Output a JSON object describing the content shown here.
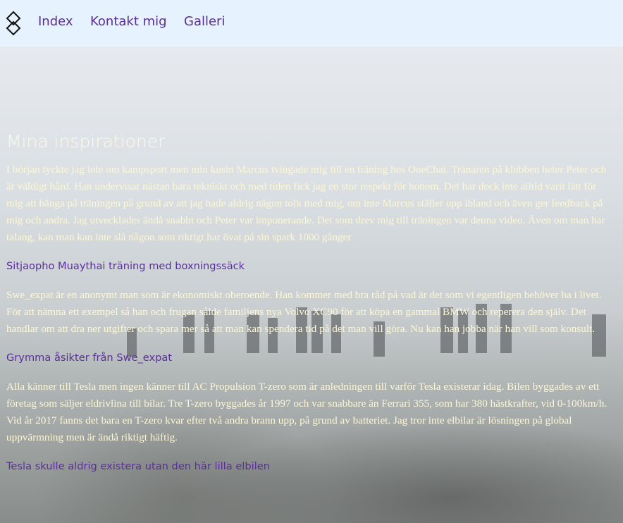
{
  "nav": {
    "logo_icon": "diamond-logo-icon",
    "links": [
      "Index",
      "Kontakt mig",
      "Galleri"
    ]
  },
  "main": {
    "heading": "Mina inspirationer",
    "paragraph_1": "I början tyckte jag inte om kampsport men min kusin Marcus tvingade mig till en träning hos OneChai. Tränaren på klubben heter Peter och är väldigt hård. Han undervisar nästan bara tekniskt och med tiden fick jag en stor respekt för honom. Det har dock inte alltid varit lätt för mig att hänga på träningen på grund av att jag hade aldrig någon tolk med mig, om inte Marcus ställer upp ibland och även ger feedback på mig och andra. Jag utvecklades ändå snabbt och Peter var imponerande. Det som drev mig till träningen var denna video. Även om man har talang, kan man kan inte slå någon som riktigt har övat på sin spark 1000 gånger",
    "link_1": "Sitjaopho Muaythai träning med boxningssäck",
    "paragraph_2": "Swe_expat är en anonymt man som är ekonomiskt oberoende. Han kommer med bra råd på vad är det som vi egentligen behöver ha i livet. För att nämna ett exempel så han och frugan sålde familjens nya Volvo XC90 för att köpa en gammal BMW och reperera den själv. Det handlar om att dra ner utgifter och spara mer så att man kan spendera tid på det man vill göra. Nu kan han jobba när han vill som konsult.",
    "link_2": "Grymma åsikter från Swe_expat",
    "paragraph_3": "Alla känner till Tesla men ingen känner till AC Propulsion T-zero som är anledningen till varför Tesla existerar idag. Bilen byggades av ett företag som säljer eldrivlina till bilar. Tre T-zero byggades år 1997 och var snabbare än Ferrari 355, som har 380 hästkrafter, vid 0-100km/h. Vid år 2017 fanns det bara en T-zero kvar efter två andra brann upp, på grund av batteriet. Jag tror inte elbilar är lösningen på global uppvärmning men är ändå riktigt häftig.",
    "link_3": "Tesla skulle aldrig existera utan den här lilla elbilen"
  },
  "colors": {
    "nav_bg": "#e6f2fd",
    "link": "#5b2e91",
    "text": "#fdf7d8"
  }
}
